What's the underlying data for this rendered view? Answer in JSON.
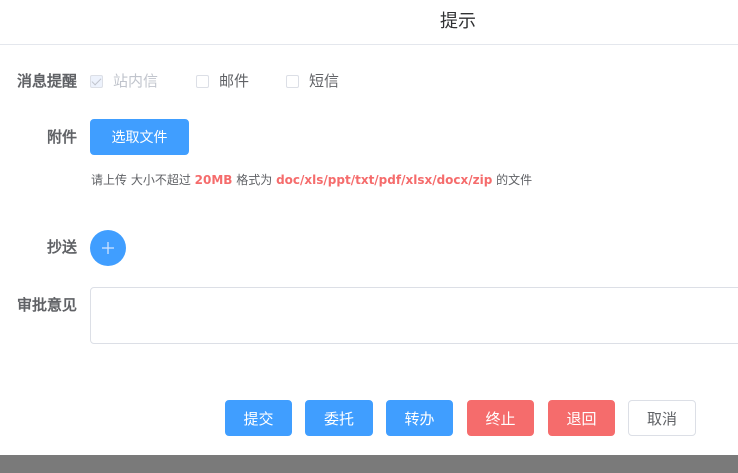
{
  "dialog": {
    "title": "提示"
  },
  "notify": {
    "label": "消息提醒",
    "options": [
      {
        "label": "站内信",
        "checked": true,
        "disabled": true
      },
      {
        "label": "邮件",
        "checked": false,
        "disabled": false
      },
      {
        "label": "短信",
        "checked": false,
        "disabled": false
      }
    ]
  },
  "attachment": {
    "label": "附件",
    "button": "选取文件",
    "tip": {
      "prefix": "请上传 大小不超过 ",
      "size": "20MB",
      "middle": " 格式为 ",
      "formats": "doc/xls/ppt/txt/pdf/xlsx/docx/zip",
      "suffix": " 的文件"
    }
  },
  "cc": {
    "label": "抄送",
    "add_icon": "plus-icon"
  },
  "opinion": {
    "label": "审批意见",
    "value": ""
  },
  "actions": {
    "submit": "提交",
    "delegate": "委托",
    "transfer": "转办",
    "terminate": "终止",
    "return": "退回",
    "cancel": "取消"
  },
  "colors": {
    "primary": "#409eff",
    "danger": "#f56c6c",
    "text": "#606266",
    "border": "#dcdfe6"
  }
}
